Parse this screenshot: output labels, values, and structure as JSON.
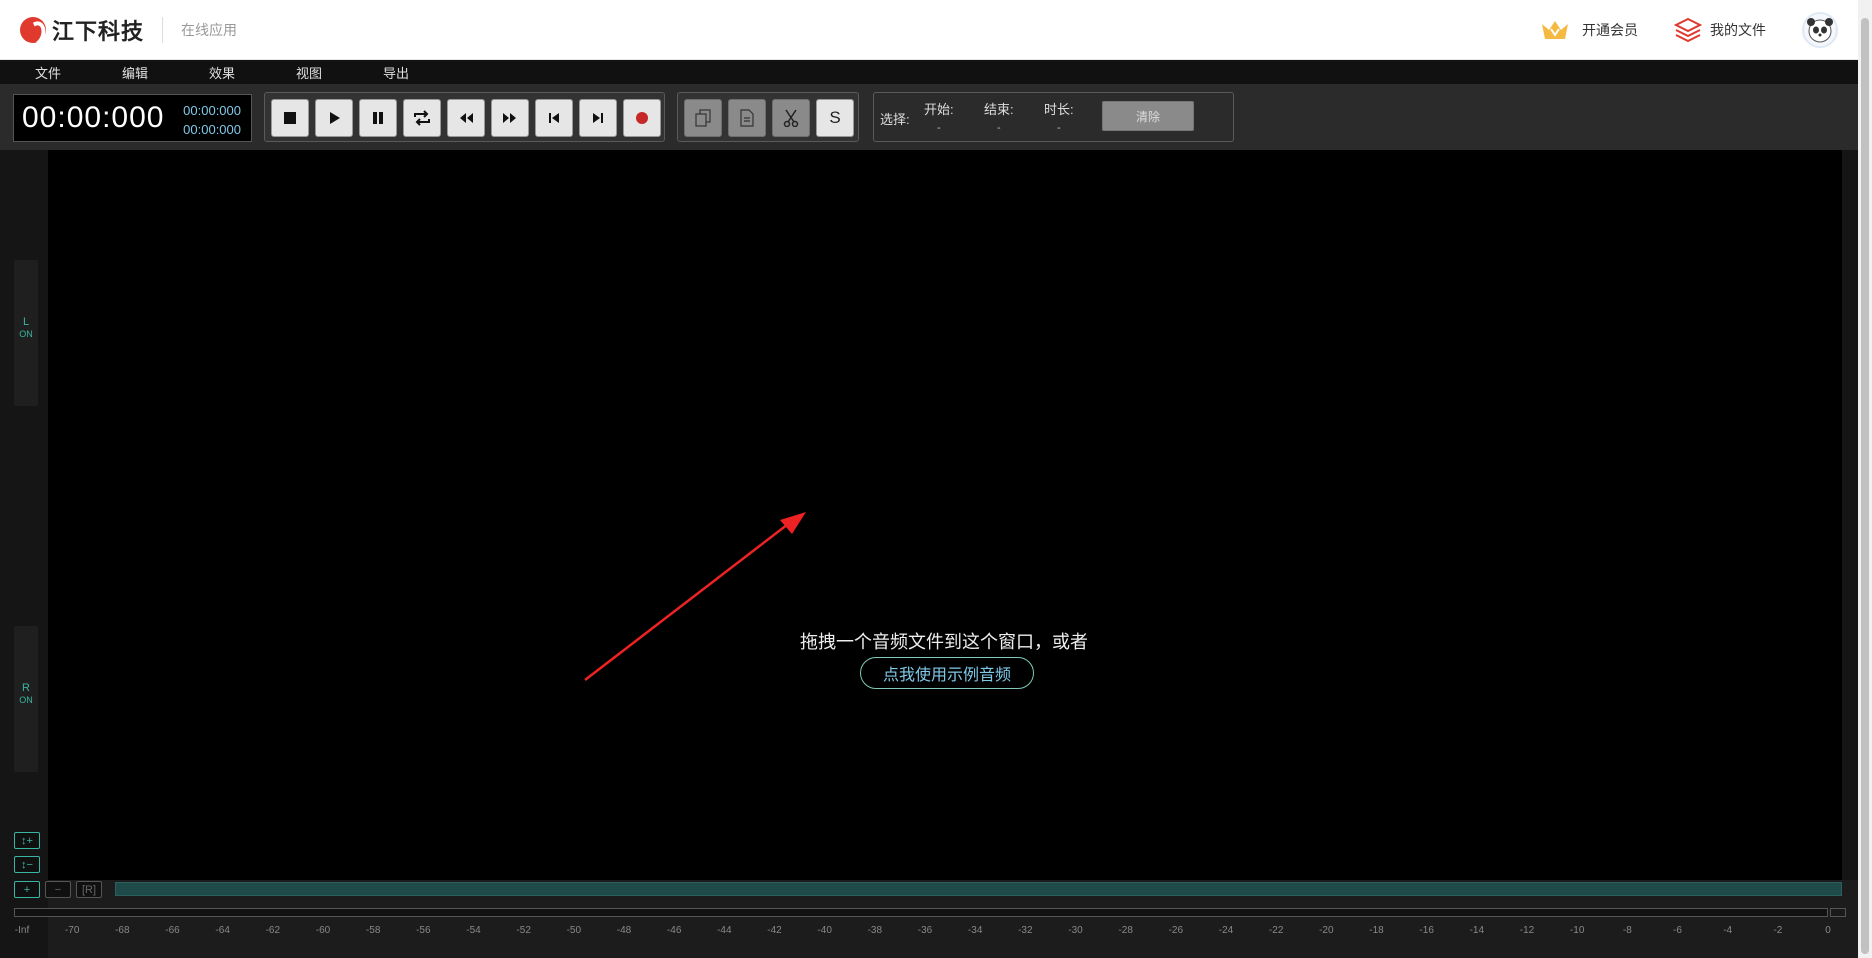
{
  "header": {
    "brand": "江下科技",
    "subtitle": "在线应用",
    "vip_label": "开通会员",
    "files_label": "我的文件"
  },
  "menu": [
    "文件",
    "编辑",
    "效果",
    "视图",
    "导出"
  ],
  "time": {
    "main": "00:00:000",
    "start": "00:00:000",
    "end": "00:00:000"
  },
  "transport": [
    "stop-icon",
    "play-icon",
    "pause-icon",
    "loop-icon",
    "rewind-icon",
    "fast-forward-icon",
    "skip-start-icon",
    "skip-end-icon",
    "record-icon"
  ],
  "edit_tools": {
    "s_label": "S"
  },
  "selection": {
    "label": "选择:",
    "start_label": "开始:",
    "start_value": "-",
    "end_label": "结束:",
    "end_value": "-",
    "duration_label": "时长:",
    "duration_value": "-",
    "clear_label": "清除"
  },
  "channels": {
    "left": {
      "name": "L",
      "state": "ON"
    },
    "right": {
      "name": "R",
      "state": "ON"
    }
  },
  "drop": {
    "text": "拖拽一个音频文件到这个窗口，或者",
    "sample_button": "点我使用示例音频"
  },
  "zoom": {
    "v_in": "↕+",
    "v_out": "↕−",
    "h_in": "+",
    "h_out": "−",
    "reset": "[R]"
  },
  "db_scale": [
    "-Inf",
    "-70",
    "-68",
    "-66",
    "-64",
    "-62",
    "-60",
    "-58",
    "-56",
    "-54",
    "-52",
    "-50",
    "-48",
    "-46",
    "-44",
    "-42",
    "-40",
    "-38",
    "-36",
    "-34",
    "-32",
    "-30",
    "-28",
    "-26",
    "-24",
    "-22",
    "-20",
    "-18",
    "-16",
    "-14",
    "-12",
    "-10",
    "-8",
    "-6",
    "-4",
    "-2",
    "0"
  ],
  "colors": {
    "accent": "#39b6a0",
    "time_sub": "#7fc9e8",
    "brand_red": "#e03a2f",
    "arrow": "#ee2222"
  }
}
